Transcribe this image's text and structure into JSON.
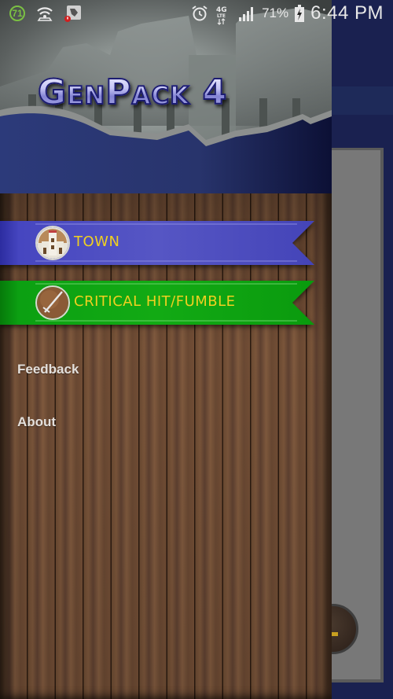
{
  "status_bar": {
    "notification_badge": "71",
    "icons_left": [
      "notification-count-icon",
      "wifi-hotspot-icon",
      "app-alert-icon"
    ],
    "icons_right": [
      "alarm-icon",
      "lte-4g-icon",
      "signal-strength-icon",
      "battery-charging-icon"
    ],
    "network_label": "4G LTE",
    "battery_percent": "71%",
    "time": "6:44 PM"
  },
  "drawer": {
    "header": {
      "title": "GenPack 4"
    },
    "banners": [
      {
        "label": "TOWN",
        "icon": "castle-icon",
        "color": "#4a4ac0"
      },
      {
        "label": "CRITICAL HIT/FUMBLE",
        "icon": "sword-shield-icon",
        "color": "#0aa010"
      }
    ],
    "links": [
      {
        "label": "Feedback"
      },
      {
        "label": "About"
      }
    ]
  },
  "colors": {
    "banner_text": "#f0d020",
    "link_text": "#e4e0dc",
    "background_app": "#1a2150"
  }
}
